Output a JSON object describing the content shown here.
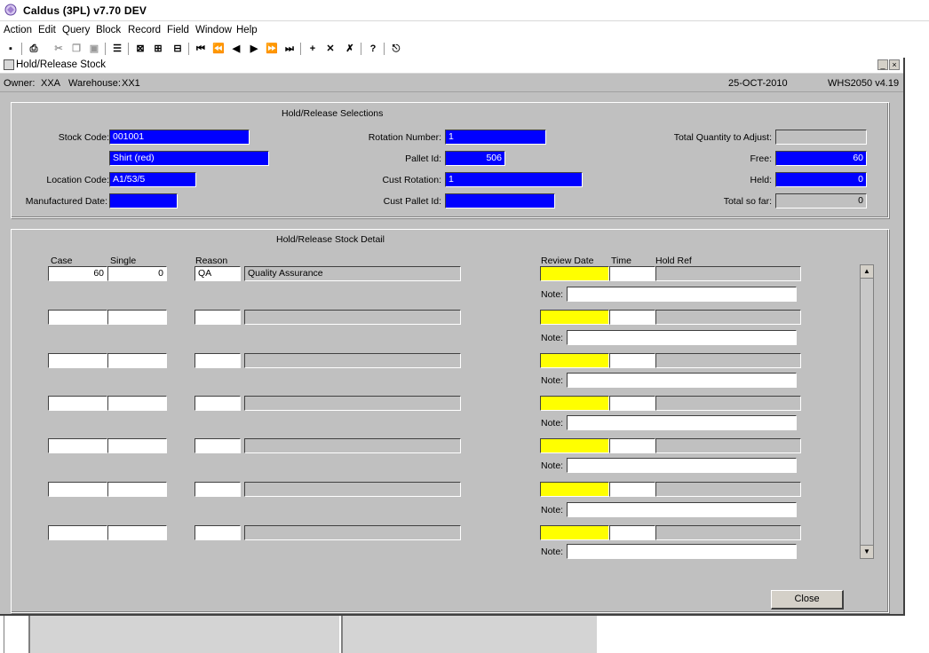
{
  "app": {
    "title": "Caldus (3PL) v7.70 DEV"
  },
  "menu": [
    "Action",
    "Edit",
    "Query",
    "Block",
    "Record",
    "Field",
    "Window",
    "Help"
  ],
  "window": {
    "title": "Hold/Release Stock"
  },
  "info": {
    "owner_label": "Owner:",
    "owner_value": "XXA",
    "warehouse_label": "Warehouse:",
    "warehouse_value": "XX1",
    "date": "25-OCT-2010",
    "form_code": "WHS2050 v4.19"
  },
  "selections": {
    "title": "Hold/Release Selections",
    "stock_code_label": "Stock Code:",
    "stock_code": "001001",
    "description": "Shirt (red)",
    "location_code_label": "Location Code:",
    "location_code": "A1/53/5",
    "manufactured_date_label": "Manufactured Date:",
    "manufactured_date": "",
    "rotation_number_label": "Rotation Number:",
    "rotation_number": "1",
    "pallet_id_label": "Pallet Id:",
    "pallet_id": "506",
    "cust_rotation_label": "Cust Rotation:",
    "cust_rotation": "1",
    "cust_pallet_id_label": "Cust Pallet Id:",
    "cust_pallet_id": "",
    "total_qty_label": "Total Quantity to Adjust:",
    "total_qty": "",
    "free_label": "Free:",
    "free": "60",
    "held_label": "Held:",
    "held": "0",
    "total_so_far_label": "Total so far:",
    "total_so_far": "0"
  },
  "detail": {
    "title": "Hold/Release Stock Detail",
    "col_case": "Case",
    "col_single": "Single",
    "col_reason": "Reason",
    "col_review_date": "Review Date",
    "col_time": "Time",
    "col_hold_ref": "Hold Ref",
    "note_label": "Note:",
    "rows": [
      {
        "case": "60",
        "single": "0",
        "reason": "QA",
        "reason_desc": "Quality Assurance",
        "review_date": "",
        "time": "",
        "hold_ref": "",
        "note": ""
      },
      {
        "case": "",
        "single": "",
        "reason": "",
        "reason_desc": "",
        "review_date": "",
        "time": "",
        "hold_ref": "",
        "note": ""
      },
      {
        "case": "",
        "single": "",
        "reason": "",
        "reason_desc": "",
        "review_date": "",
        "time": "",
        "hold_ref": "",
        "note": ""
      },
      {
        "case": "",
        "single": "",
        "reason": "",
        "reason_desc": "",
        "review_date": "",
        "time": "",
        "hold_ref": "",
        "note": ""
      },
      {
        "case": "",
        "single": "",
        "reason": "",
        "reason_desc": "",
        "review_date": "",
        "time": "",
        "hold_ref": "",
        "note": ""
      },
      {
        "case": "",
        "single": "",
        "reason": "",
        "reason_desc": "",
        "review_date": "",
        "time": "",
        "hold_ref": "",
        "note": ""
      },
      {
        "case": "",
        "single": "",
        "reason": "",
        "reason_desc": "",
        "review_date": "",
        "time": "",
        "hold_ref": "",
        "note": ""
      }
    ]
  },
  "buttons": {
    "close": "Close"
  },
  "colors": {
    "field_blue": "#0000ff",
    "review_yellow": "#ffff00",
    "form_grey": "#c0c0c0"
  }
}
